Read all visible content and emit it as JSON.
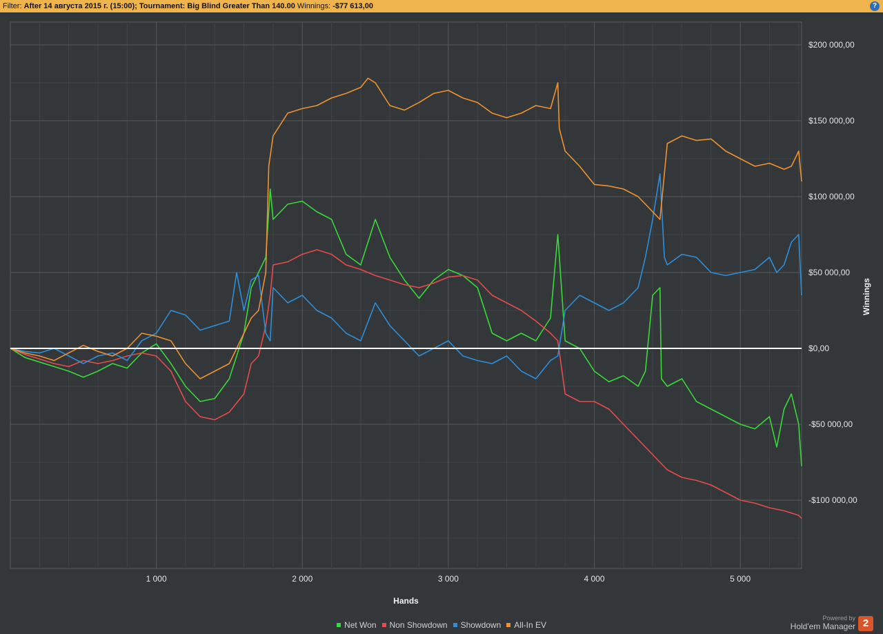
{
  "filter_bar": {
    "label": "Filter:",
    "criteria": "After 14 августа 2015 г. (15:00); Tournament: Big Blind Greater Than 140.00",
    "winnings_label": "Winnings:",
    "winnings_value": "-$77 613,00",
    "help_icon": "question-icon"
  },
  "branding": {
    "powered_by": "Powered by",
    "product": "Hold'em Manager",
    "logo_text": "2"
  },
  "chart_data": {
    "type": "line",
    "xlabel": "Hands",
    "ylabel": "Winnings",
    "xlim": [
      0,
      5420
    ],
    "ylim": [
      -145000,
      215000
    ],
    "x_ticks": [
      1000,
      2000,
      3000,
      4000,
      5000
    ],
    "x_tick_labels": [
      "1 000",
      "2 000",
      "3 000",
      "4 000",
      "5 000"
    ],
    "y_ticks": [
      200000,
      150000,
      100000,
      50000,
      0,
      -50000,
      -100000
    ],
    "y_tick_labels": [
      "$200 000,00",
      "$150 000,00",
      "$100 000,00",
      "$50 000,00",
      "$0,00",
      "-$50 000,00",
      "-$100 000,00"
    ],
    "grid": true,
    "legend_position": "bottom-center",
    "series": [
      {
        "name": "Net Won",
        "color": "#39d939",
        "x": [
          0,
          100,
          200,
          300,
          400,
          500,
          600,
          700,
          800,
          900,
          1000,
          1100,
          1200,
          1300,
          1400,
          1500,
          1600,
          1650,
          1700,
          1750,
          1780,
          1800,
          1900,
          2000,
          2100,
          2200,
          2300,
          2400,
          2500,
          2600,
          2700,
          2800,
          2900,
          3000,
          3100,
          3200,
          3300,
          3400,
          3500,
          3600,
          3700,
          3750,
          3800,
          3900,
          4000,
          4100,
          4200,
          4300,
          4350,
          4400,
          4450,
          4460,
          4500,
          4600,
          4700,
          4800,
          4900,
          5000,
          5100,
          5200,
          5250,
          5300,
          5350,
          5400,
          5420
        ],
        "y": [
          0,
          -6000,
          -9000,
          -12000,
          -15000,
          -19000,
          -15000,
          -10000,
          -13000,
          -3000,
          3000,
          -10000,
          -25000,
          -35000,
          -33000,
          -20000,
          10000,
          40000,
          50000,
          60000,
          105000,
          85000,
          95000,
          97000,
          90000,
          85000,
          62000,
          55000,
          85000,
          60000,
          45000,
          33000,
          45000,
          52000,
          48000,
          40000,
          10000,
          5000,
          10000,
          5000,
          20000,
          75000,
          5000,
          0,
          -15000,
          -22000,
          -18000,
          -25000,
          -15000,
          35000,
          40000,
          -20000,
          -25000,
          -20000,
          -35000,
          -40000,
          -45000,
          -50000,
          -53000,
          -45000,
          -65000,
          -40000,
          -30000,
          -50000,
          -77613
        ]
      },
      {
        "name": "Non Showdown",
        "color": "#e84b4b",
        "x": [
          0,
          100,
          200,
          300,
          400,
          500,
          600,
          700,
          800,
          900,
          1000,
          1100,
          1200,
          1300,
          1400,
          1500,
          1600,
          1650,
          1700,
          1750,
          1780,
          1800,
          1900,
          2000,
          2100,
          2200,
          2300,
          2400,
          2500,
          2600,
          2700,
          2800,
          2900,
          3000,
          3100,
          3200,
          3300,
          3400,
          3500,
          3600,
          3700,
          3750,
          3800,
          3900,
          4000,
          4100,
          4200,
          4300,
          4400,
          4500,
          4600,
          4700,
          4800,
          4900,
          5000,
          5100,
          5200,
          5300,
          5400,
          5420
        ],
        "y": [
          0,
          -4000,
          -7000,
          -10000,
          -12000,
          -8000,
          -10000,
          -8000,
          -5000,
          -3000,
          -5000,
          -15000,
          -35000,
          -45000,
          -47000,
          -42000,
          -30000,
          -10000,
          -5000,
          15000,
          35000,
          55000,
          57000,
          62000,
          65000,
          62000,
          55000,
          52000,
          48000,
          45000,
          42000,
          40000,
          43000,
          47000,
          48000,
          45000,
          35000,
          30000,
          25000,
          18000,
          10000,
          5000,
          -30000,
          -35000,
          -35000,
          -40000,
          -50000,
          -60000,
          -70000,
          -80000,
          -85000,
          -87000,
          -90000,
          -95000,
          -100000,
          -102000,
          -105000,
          -107000,
          -110000,
          -112000
        ]
      },
      {
        "name": "Showdown",
        "color": "#2d8fdb",
        "x": [
          0,
          100,
          200,
          300,
          400,
          500,
          600,
          700,
          800,
          900,
          1000,
          1100,
          1200,
          1300,
          1400,
          1500,
          1550,
          1600,
          1650,
          1700,
          1750,
          1780,
          1800,
          1900,
          2000,
          2100,
          2200,
          2300,
          2400,
          2500,
          2600,
          2700,
          2800,
          2900,
          3000,
          3100,
          3200,
          3300,
          3400,
          3500,
          3600,
          3700,
          3750,
          3800,
          3900,
          4000,
          4100,
          4200,
          4300,
          4350,
          4400,
          4450,
          4480,
          4500,
          4600,
          4700,
          4800,
          4900,
          5000,
          5100,
          5200,
          5250,
          5300,
          5350,
          5400,
          5420
        ],
        "y": [
          0,
          -2000,
          -3000,
          0,
          -5000,
          -10000,
          -5000,
          -3000,
          -8000,
          5000,
          10000,
          25000,
          22000,
          12000,
          15000,
          18000,
          50000,
          25000,
          45000,
          48000,
          10000,
          5000,
          40000,
          30000,
          35000,
          25000,
          20000,
          10000,
          5000,
          30000,
          15000,
          5000,
          -5000,
          0,
          5000,
          -5000,
          -8000,
          -10000,
          -5000,
          -15000,
          -20000,
          -8000,
          -5000,
          25000,
          35000,
          30000,
          25000,
          30000,
          40000,
          60000,
          85000,
          115000,
          60000,
          55000,
          62000,
          60000,
          50000,
          48000,
          50000,
          52000,
          60000,
          50000,
          55000,
          70000,
          75000,
          35000
        ]
      },
      {
        "name": "All-In EV",
        "color": "#f0922f",
        "x": [
          0,
          100,
          200,
          300,
          400,
          500,
          600,
          700,
          800,
          900,
          1000,
          1100,
          1200,
          1300,
          1400,
          1500,
          1600,
          1650,
          1700,
          1750,
          1770,
          1800,
          1900,
          2000,
          2100,
          2200,
          2300,
          2400,
          2450,
          2500,
          2600,
          2700,
          2800,
          2900,
          3000,
          3100,
          3200,
          3300,
          3400,
          3500,
          3600,
          3700,
          3750,
          3760,
          3800,
          3900,
          4000,
          4100,
          4200,
          4300,
          4350,
          4400,
          4450,
          4480,
          4500,
          4600,
          4700,
          4800,
          4900,
          5000,
          5100,
          5200,
          5300,
          5350,
          5400,
          5420
        ],
        "y": [
          0,
          -3000,
          -5000,
          -8000,
          -3000,
          2000,
          -2000,
          -5000,
          0,
          10000,
          8000,
          5000,
          -10000,
          -20000,
          -15000,
          -10000,
          10000,
          20000,
          25000,
          50000,
          120000,
          140000,
          155000,
          158000,
          160000,
          165000,
          168000,
          172000,
          178000,
          175000,
          160000,
          157000,
          162000,
          168000,
          170000,
          165000,
          162000,
          155000,
          152000,
          155000,
          160000,
          158000,
          175000,
          145000,
          130000,
          120000,
          108000,
          107000,
          105000,
          100000,
          95000,
          90000,
          85000,
          115000,
          135000,
          140000,
          137000,
          138000,
          130000,
          125000,
          120000,
          122000,
          118000,
          120000,
          130000,
          110000
        ]
      }
    ]
  }
}
